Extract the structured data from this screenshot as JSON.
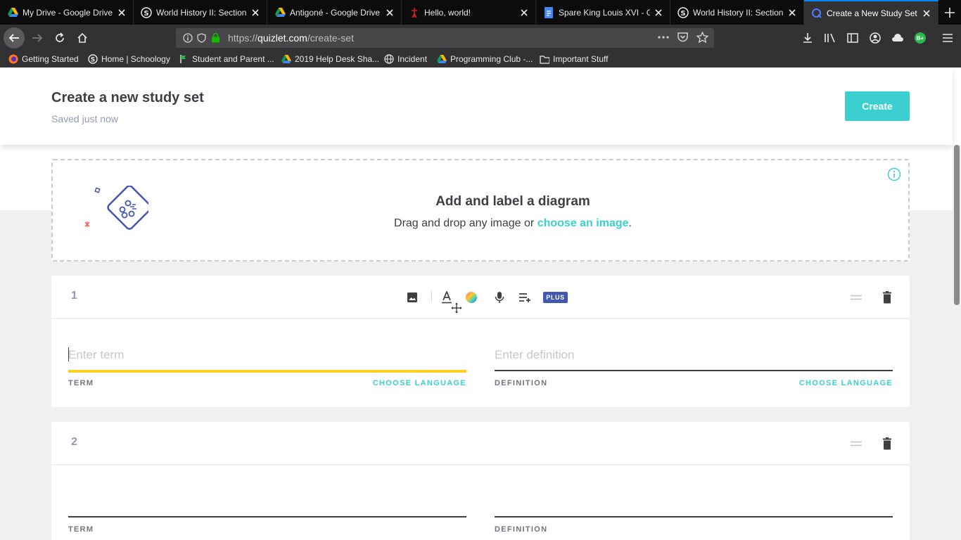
{
  "browser": {
    "tabs": [
      {
        "title": "My Drive - Google Drive",
        "icon": "google-drive-icon"
      },
      {
        "title": "World History II: Section",
        "icon": "schoology-icon"
      },
      {
        "title": "Antigoné - Google Drive",
        "icon": "google-drive-icon"
      },
      {
        "title": "Hello, world!",
        "icon": "site-icon"
      },
      {
        "title": "Spare King Louis XVI - G",
        "icon": "google-docs-icon"
      },
      {
        "title": "World History II: Section",
        "icon": "schoology-icon"
      },
      {
        "title": "Create a New Study Set |",
        "icon": "quizlet-icon"
      }
    ],
    "url": {
      "protocol": "https://",
      "domain": "quizlet.com",
      "path": "/create-set"
    },
    "extension_badge": "B+",
    "bookmarks": [
      {
        "label": "Getting Started",
        "icon": "firefox-icon"
      },
      {
        "label": "Home | Schoology",
        "icon": "schoology-icon"
      },
      {
        "label": "Student and Parent ...",
        "icon": "flag-icon"
      },
      {
        "label": "2019 Help Desk Sha...",
        "icon": "google-drive-icon"
      },
      {
        "label": "Incident",
        "icon": "globe-icon"
      },
      {
        "label": "Programming Club -...",
        "icon": "google-drive-icon"
      },
      {
        "label": "Important Stuff",
        "icon": "folder-icon"
      }
    ]
  },
  "header": {
    "title": "Create a new study set",
    "save_status": "Saved just now",
    "create_label": "Create"
  },
  "diagram": {
    "title": "Add and label a diagram",
    "subtitle_before": "Drag and drop any image or ",
    "link_text": "choose an image",
    "subtitle_after": "."
  },
  "cards": [
    {
      "number": "1",
      "term_placeholder": "Enter term",
      "definition_placeholder": "Enter definition",
      "term_label": "TERM",
      "definition_label": "DEFINITION",
      "choose_language": "CHOOSE LANGUAGE",
      "plus_badge": "PLUS"
    },
    {
      "number": "2",
      "term_label": "TERM",
      "definition_label": "DEFINITION"
    }
  ],
  "colors": {
    "accent": "#3ccfcf",
    "active_underline": "#ffcd1f",
    "plus_badge": "#4257b2",
    "text_dark": "#3c4043",
    "text_muted": "#939bb4"
  }
}
